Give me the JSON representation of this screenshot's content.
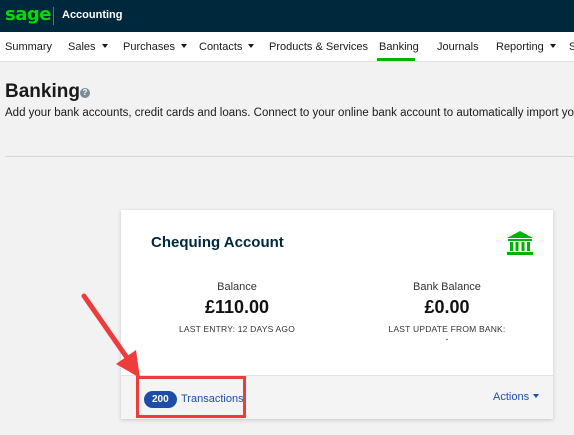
{
  "topbar": {
    "logo": "sage",
    "app_title": "Accounting",
    "logo_color": "#00dc00",
    "bg_color": "#00283d"
  },
  "nav": {
    "items": [
      {
        "label": "Summary",
        "has_menu": false
      },
      {
        "label": "Sales",
        "has_menu": true
      },
      {
        "label": "Purchases",
        "has_menu": true
      },
      {
        "label": "Contacts",
        "has_menu": true
      },
      {
        "label": "Products & Services",
        "has_menu": false
      },
      {
        "label": "Banking",
        "has_menu": false,
        "active": true
      },
      {
        "label": "Journals",
        "has_menu": false
      },
      {
        "label": "Reporting",
        "has_menu": true
      },
      {
        "label": "S",
        "has_menu": false
      }
    ],
    "active_color": "#00b300"
  },
  "page": {
    "title": "Banking",
    "intro": "Add your bank accounts, credit cards and loans. Connect to your online bank account to automatically import your transactions."
  },
  "account": {
    "name": "Chequing Account",
    "icon": "bank-icon",
    "balance": {
      "label": "Balance",
      "amount": "£110.00",
      "sub": "LAST ENTRY: 12 DAYS AGO"
    },
    "bank_balance": {
      "label": "Bank Balance",
      "amount": "£0.00",
      "sub": "LAST UPDATE FROM BANK:",
      "sub_value": "-"
    },
    "transactions": {
      "count": "200",
      "label": "Transactions"
    },
    "actions_label": "Actions"
  },
  "annotation": {
    "color": "#ee3b3b"
  }
}
